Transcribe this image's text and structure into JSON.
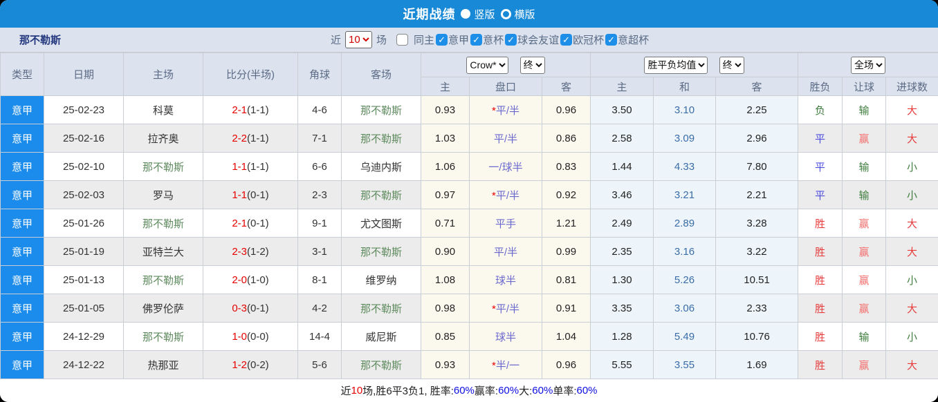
{
  "titlebar": {
    "title": "近期战绩",
    "layout_options": [
      {
        "label": "竖版",
        "selected": true
      },
      {
        "label": "横版",
        "selected": false
      }
    ]
  },
  "filter": {
    "team": "那不勒斯",
    "near_label": "近",
    "games_value": "10",
    "games_suffix": "场",
    "checkboxes": [
      {
        "label": "同主",
        "checked": false
      },
      {
        "label": "意甲",
        "checked": true
      },
      {
        "label": "意杯",
        "checked": true
      },
      {
        "label": "球会友谊",
        "checked": true
      },
      {
        "label": "欧冠杯",
        "checked": true
      },
      {
        "label": "意超杯",
        "checked": true
      }
    ]
  },
  "table": {
    "main_headers": [
      "类型",
      "日期",
      "主场",
      "比分(半场)",
      "角球",
      "客场"
    ],
    "selects": {
      "handicap_source": "Crow*",
      "handicap_state": "终",
      "avg_source": "胜平负均值",
      "avg_state": "终",
      "result_scope": "全场"
    },
    "sub_headers": [
      "主",
      "盘口",
      "客",
      "主",
      "和",
      "客",
      "胜负",
      "让球",
      "进球数"
    ],
    "rows": [
      {
        "league": "意甲",
        "date": "25-02-23",
        "home": "科莫",
        "home_green": false,
        "score": "2-1",
        "half": "(1-1)",
        "corner": "4-6",
        "away": "那不勒斯",
        "away_green": true,
        "odds_home": "0.93",
        "handicap": "*平/半",
        "odds_away": "0.96",
        "avg_win": "3.50",
        "avg_draw": "3.10",
        "avg_lose": "2.25",
        "result": "负",
        "result_color": "green",
        "let_ball": "输",
        "let_color": "green",
        "goals": "大",
        "goals_color": "red"
      },
      {
        "league": "意甲",
        "date": "25-02-16",
        "home": "拉齐奥",
        "home_green": false,
        "score": "2-2",
        "half": "(1-1)",
        "corner": "7-1",
        "away": "那不勒斯",
        "away_green": true,
        "odds_home": "1.03",
        "handicap": "平/半",
        "odds_away": "0.86",
        "avg_win": "2.58",
        "avg_draw": "3.09",
        "avg_lose": "2.96",
        "result": "平",
        "result_color": "blue",
        "let_ball": "赢",
        "let_color": "pink",
        "goals": "大",
        "goals_color": "red"
      },
      {
        "league": "意甲",
        "date": "25-02-10",
        "home": "那不勒斯",
        "home_green": true,
        "score": "1-1",
        "half": "(1-1)",
        "corner": "6-6",
        "away": "乌迪内斯",
        "away_green": false,
        "odds_home": "1.06",
        "handicap": "一/球半",
        "odds_away": "0.83",
        "avg_win": "1.44",
        "avg_draw": "4.33",
        "avg_lose": "7.80",
        "result": "平",
        "result_color": "blue",
        "let_ball": "输",
        "let_color": "green",
        "goals": "小",
        "goals_color": "green"
      },
      {
        "league": "意甲",
        "date": "25-02-03",
        "home": "罗马",
        "home_green": false,
        "score": "1-1",
        "half": "(0-1)",
        "corner": "2-3",
        "away": "那不勒斯",
        "away_green": true,
        "odds_home": "0.97",
        "handicap": "*平/半",
        "odds_away": "0.92",
        "avg_win": "3.46",
        "avg_draw": "3.21",
        "avg_lose": "2.21",
        "result": "平",
        "result_color": "blue",
        "let_ball": "输",
        "let_color": "green",
        "goals": "小",
        "goals_color": "green"
      },
      {
        "league": "意甲",
        "date": "25-01-26",
        "home": "那不勒斯",
        "home_green": true,
        "score": "2-1",
        "half": "(0-1)",
        "corner": "9-1",
        "away": "尤文图斯",
        "away_green": false,
        "odds_home": "0.71",
        "handicap": "平手",
        "odds_away": "1.21",
        "avg_win": "2.49",
        "avg_draw": "2.89",
        "avg_lose": "3.28",
        "result": "胜",
        "result_color": "red",
        "let_ball": "赢",
        "let_color": "pink",
        "goals": "大",
        "goals_color": "red"
      },
      {
        "league": "意甲",
        "date": "25-01-19",
        "home": "亚特兰大",
        "home_green": false,
        "score": "2-3",
        "half": "(1-2)",
        "corner": "3-1",
        "away": "那不勒斯",
        "away_green": true,
        "odds_home": "0.90",
        "handicap": "平/半",
        "odds_away": "0.99",
        "avg_win": "2.35",
        "avg_draw": "3.16",
        "avg_lose": "3.22",
        "result": "胜",
        "result_color": "red",
        "let_ball": "赢",
        "let_color": "pink",
        "goals": "大",
        "goals_color": "red"
      },
      {
        "league": "意甲",
        "date": "25-01-13",
        "home": "那不勒斯",
        "home_green": true,
        "score": "2-0",
        "half": "(1-0)",
        "corner": "8-1",
        "away": "维罗纳",
        "away_green": false,
        "odds_home": "1.08",
        "handicap": "球半",
        "odds_away": "0.81",
        "avg_win": "1.30",
        "avg_draw": "5.26",
        "avg_lose": "10.51",
        "result": "胜",
        "result_color": "red",
        "let_ball": "赢",
        "let_color": "pink",
        "goals": "小",
        "goals_color": "green"
      },
      {
        "league": "意甲",
        "date": "25-01-05",
        "home": "佛罗伦萨",
        "home_green": false,
        "score": "0-3",
        "half": "(0-1)",
        "corner": "4-2",
        "away": "那不勒斯",
        "away_green": true,
        "odds_home": "0.98",
        "handicap": "*平/半",
        "odds_away": "0.91",
        "avg_win": "3.35",
        "avg_draw": "3.06",
        "avg_lose": "2.33",
        "result": "胜",
        "result_color": "red",
        "let_ball": "赢",
        "let_color": "pink",
        "goals": "大",
        "goals_color": "red"
      },
      {
        "league": "意甲",
        "date": "24-12-29",
        "home": "那不勒斯",
        "home_green": true,
        "score": "1-0",
        "half": "(0-0)",
        "corner": "14-4",
        "away": "威尼斯",
        "away_green": false,
        "odds_home": "0.85",
        "handicap": "球半",
        "odds_away": "1.04",
        "avg_win": "1.28",
        "avg_draw": "5.49",
        "avg_lose": "10.76",
        "result": "胜",
        "result_color": "red",
        "let_ball": "输",
        "let_color": "green",
        "goals": "小",
        "goals_color": "green"
      },
      {
        "league": "意甲",
        "date": "24-12-22",
        "home": "热那亚",
        "home_green": false,
        "score": "1-2",
        "half": "(0-2)",
        "corner": "5-6",
        "away": "那不勒斯",
        "away_green": true,
        "odds_home": "0.93",
        "handicap": "*半/一",
        "odds_away": "0.96",
        "avg_win": "5.55",
        "avg_draw": "3.55",
        "avg_lose": "1.69",
        "result": "胜",
        "result_color": "red",
        "let_ball": "赢",
        "let_color": "pink",
        "goals": "大",
        "goals_color": "red"
      }
    ]
  },
  "footer": {
    "segments": [
      {
        "text": "近",
        "color": "black"
      },
      {
        "text": "10",
        "color": "red"
      },
      {
        "text": "场,胜6平3负1, 胜率:",
        "color": "black"
      },
      {
        "text": "60%",
        "color": "blue"
      },
      {
        "text": " 赢率:",
        "color": "black"
      },
      {
        "text": "60%",
        "color": "blue"
      },
      {
        "text": " 大:",
        "color": "black"
      },
      {
        "text": "60%",
        "color": "blue"
      },
      {
        "text": " 单率:",
        "color": "black"
      },
      {
        "text": "60%",
        "color": "blue"
      }
    ]
  }
}
